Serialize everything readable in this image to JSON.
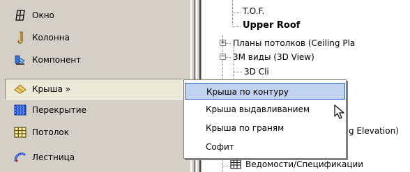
{
  "design_bar": {
    "items": [
      {
        "label": "Окно",
        "icon": "window-icon"
      },
      {
        "label": "Колонна",
        "icon": "column-icon"
      },
      {
        "label": "Компонент",
        "icon": "component-icon"
      },
      {
        "label": "Крыша »",
        "icon": "roof-icon"
      },
      {
        "label": "Перекрытие",
        "icon": "floor-icon"
      },
      {
        "label": "Потолок",
        "icon": "ceiling-icon"
      },
      {
        "label": "Лестница",
        "icon": "stair-icon"
      }
    ]
  },
  "project_browser": {
    "rows": [
      {
        "label": "T.O.F."
      },
      {
        "label": "Upper Roof"
      },
      {
        "label": "Планы потолков (Ceiling Pla"
      },
      {
        "label": "3М виды (3D View)"
      },
      {
        "label": "3D Cli"
      },
      {
        "label": "g Elevation)"
      },
      {
        "label": "Ведомости/Спецификации"
      }
    ],
    "expander_plus": "+",
    "expander_minus": "−"
  },
  "popup_menu": {
    "items": [
      {
        "label": "Крыша по контуру"
      },
      {
        "label": "Крыша выдавливанием"
      },
      {
        "label": "Крыша по граням"
      },
      {
        "label": "Софит"
      }
    ],
    "highlighted_index": 0
  },
  "colors": {
    "panel_bg": "#d4d0c8",
    "menu_highlight": "#c1d2ee",
    "menu_highlight_border": "#316ac5"
  }
}
